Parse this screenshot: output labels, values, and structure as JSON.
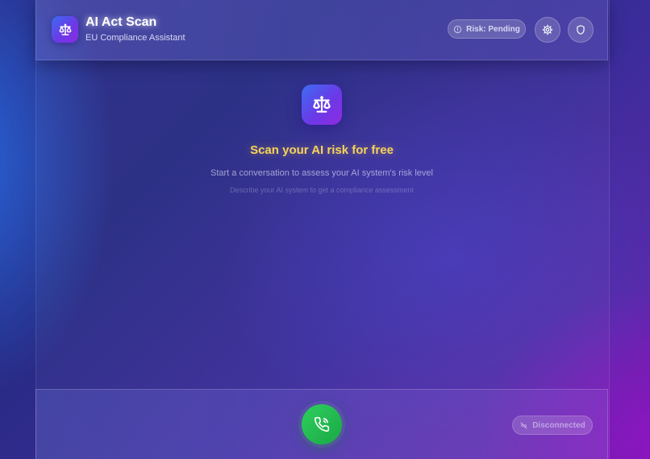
{
  "header": {
    "title": "AI Act Scan",
    "subtitle": "EU Compliance Assistant",
    "logo_icon": "scale-icon",
    "risk_status": "Risk: Pending",
    "risk_icon": "info-circle-icon",
    "buttons": [
      {
        "icon": "gear-icon"
      },
      {
        "icon": "shield-icon"
      }
    ]
  },
  "hero": {
    "icon": "scale-icon",
    "title": "Scan your AI risk for free",
    "subtitle": "Start a conversation to assess your AI system's risk level",
    "hint": "Describe your AI system to get a compliance assessment"
  },
  "footer": {
    "call_icon": "phone-icon",
    "connection_status": "Disconnected",
    "connection_icon": "unplugged-icon"
  },
  "colors": {
    "accent_gradient_start": "#3b6cf0",
    "accent_gradient_end": "#8a2be2",
    "title_yellow": "#f5d35a",
    "call_green": "#22bb50"
  }
}
